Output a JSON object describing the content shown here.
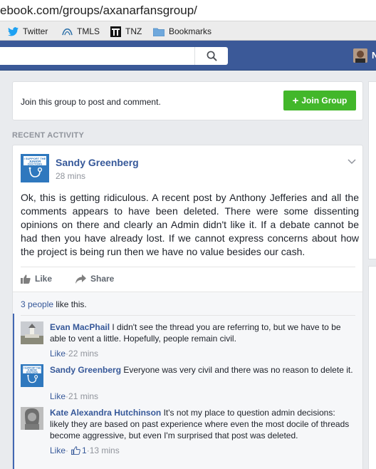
{
  "browser": {
    "url_visible": "ebook.com/groups/axanarfansgroup/",
    "bookmarks": [
      {
        "icon": "twitter-bird-icon",
        "label": "Twitter"
      },
      {
        "icon": "tmls-icon",
        "label": "TMLS"
      },
      {
        "icon": "tnz-icon",
        "label": "TNZ"
      },
      {
        "icon": "folder-icon",
        "label": "Bookmarks"
      }
    ]
  },
  "topbar": {
    "search_placeholder": "",
    "profile_initial": "N"
  },
  "join": {
    "prompt": "Join this group to post and comment.",
    "button_label": "Join Group",
    "button_color": "#42b72a"
  },
  "section_title": "RECENT ACTIVITY",
  "post": {
    "author": "Sandy Greenberg",
    "time": "28 mins",
    "avatar_text": "I SUPPORT THE JUNIOR DOCTORS",
    "body": "Ok, this is getting ridiculous. A recent post by Anthony Jefferies and all the comments appears to have been deleted. There were some dissenting opinions on there and clearly an Admin didn't like it. If a debate cannot be had then you have already lost. If we cannot express concerns about how the project is being run then we have no value besides our cash.",
    "like_label": "Like",
    "share_label": "Share",
    "likes_link": "3 people",
    "likes_suffix": " like this."
  },
  "comments": [
    {
      "name": "Evan MacPhail",
      "text": " I didn't see the thread you are referring to, but we have to be able to vent a little. Hopefully, people remain civil.",
      "like_label": "Like",
      "sep": " · ",
      "reactions": "",
      "time": "22 mins"
    },
    {
      "name": "Sandy Greenberg",
      "text": " Everyone was very civil and there was no reason to delete it.",
      "like_label": "Like",
      "sep": " · ",
      "reactions": "",
      "time": "21 mins"
    },
    {
      "name": "Kate Alexandra Hutchinson",
      "text": " It's not my place to question admin decisions: likely they are based on past experience where even the most docile of threads become aggressive, but even I'm surprised that post was deleted.",
      "like_label": "Like",
      "sep": " · ",
      "reactions": "1",
      "time": "13 mins"
    }
  ],
  "colors": {
    "fb_blue": "#3b5998",
    "link": "#365899",
    "background": "#e9ebee"
  }
}
